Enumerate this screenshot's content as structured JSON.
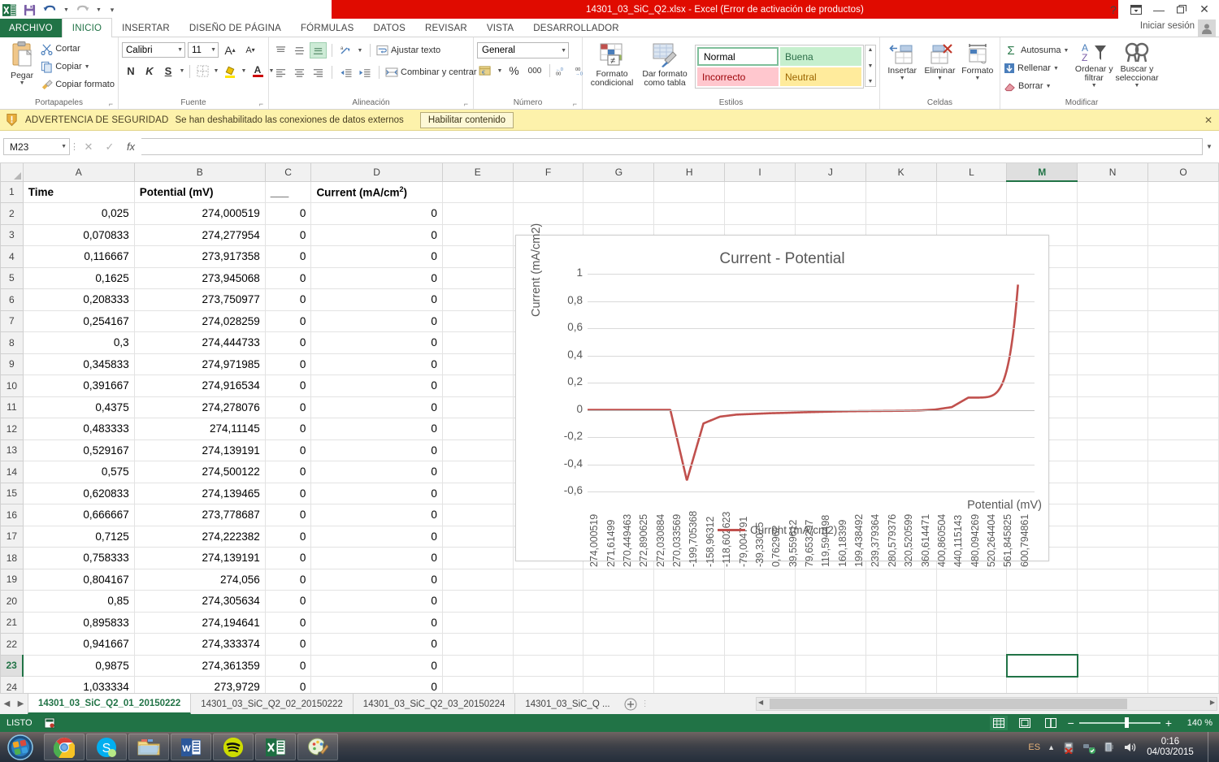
{
  "titlebar": {
    "document_title": "14301_03_SiC_Q2.xlsx  -  Excel (Error de activación de productos)",
    "qat": [
      {
        "name": "save",
        "label": "Guardar"
      },
      {
        "name": "undo",
        "label": "Deshacer"
      },
      {
        "name": "redo",
        "label": "Rehacer"
      },
      {
        "name": "customize",
        "label": "Personalizar barra"
      }
    ],
    "help": "?",
    "ribbon_display": "Opciones de presentación de la cinta",
    "minimize": "—",
    "restore": "❐",
    "close": "✕"
  },
  "ribbon_tabs": {
    "file": "ARCHIVO",
    "items": [
      "INICIO",
      "INSERTAR",
      "DISEÑO DE PÁGINA",
      "FÓRMULAS",
      "DATOS",
      "REVISAR",
      "VISTA",
      "DESARROLLADOR"
    ],
    "active": "INICIO",
    "signin": "Iniciar sesión"
  },
  "ribbon": {
    "clipboard": {
      "label": "Portapapeles",
      "paste": "Pegar",
      "cut": "Cortar",
      "copy": "Copiar",
      "format_painter": "Copiar formato"
    },
    "font": {
      "label": "Fuente",
      "font_name": "Calibri",
      "font_size": "11",
      "grow": "A",
      "shrink": "A",
      "bold": "N",
      "italic": "K",
      "underline": "S",
      "borders": "borders",
      "fill": "A",
      "color": "A"
    },
    "alignment": {
      "label": "Alineación",
      "wrap_text": "Ajustar texto",
      "merge_center": "Combinar y centrar"
    },
    "number": {
      "label": "Número",
      "format": "General",
      "percent": "%",
      "thousands": "000"
    },
    "styles": {
      "label": "Estilos",
      "conditional": "Formato condicional",
      "as_table": "Dar formato como tabla",
      "cells": [
        "Normal",
        "Buena",
        "Incorrecto",
        "Neutral"
      ]
    },
    "cells": {
      "label": "Celdas",
      "insert": "Insertar",
      "delete": "Eliminar",
      "format": "Formato"
    },
    "editing": {
      "label": "Modificar",
      "autosum": "Autosuma",
      "fill": "Rellenar",
      "clear": "Borrar",
      "sort_filter": "Ordenar y filtrar",
      "find_select": "Buscar y seleccionar"
    }
  },
  "security_bar": {
    "title": "ADVERTENCIA DE SEGURIDAD",
    "message": "Se han deshabilitado las conexiones de datos externos",
    "button": "Habilitar contenido",
    "close": "✕"
  },
  "formula_bar": {
    "name_box": "M23",
    "cancel": "✕",
    "enter": "✓",
    "function": "fx",
    "value": ""
  },
  "grid": {
    "columns": [
      "A",
      "B",
      "C",
      "D",
      "E",
      "F",
      "G",
      "H",
      "I",
      "J",
      "K",
      "L",
      "M",
      "N",
      "O"
    ],
    "selected_column": "M",
    "selected_row": "23",
    "selected_cell": "M23",
    "rows": [
      {
        "n": "1",
        "A": "Time",
        "B": "Potential (mV)",
        "C": "___",
        "D": "Current (mA/cm2)",
        "header": true
      },
      {
        "n": "2",
        "A": "0,025",
        "B": "274,000519",
        "C": "0",
        "D": "0"
      },
      {
        "n": "3",
        "A": "0,070833",
        "B": "274,277954",
        "C": "0",
        "D": "0"
      },
      {
        "n": "4",
        "A": "0,116667",
        "B": "273,917358",
        "C": "0",
        "D": "0"
      },
      {
        "n": "5",
        "A": "0,1625",
        "B": "273,945068",
        "C": "0",
        "D": "0"
      },
      {
        "n": "6",
        "A": "0,208333",
        "B": "273,750977",
        "C": "0",
        "D": "0"
      },
      {
        "n": "7",
        "A": "0,254167",
        "B": "274,028259",
        "C": "0",
        "D": "0"
      },
      {
        "n": "8",
        "A": "0,3",
        "B": "274,444733",
        "C": "0",
        "D": "0"
      },
      {
        "n": "9",
        "A": "0,345833",
        "B": "274,971985",
        "C": "0",
        "D": "0"
      },
      {
        "n": "10",
        "A": "0,391667",
        "B": "274,916534",
        "C": "0",
        "D": "0"
      },
      {
        "n": "11",
        "A": "0,4375",
        "B": "274,278076",
        "C": "0",
        "D": "0"
      },
      {
        "n": "12",
        "A": "0,483333",
        "B": "274,11145",
        "C": "0",
        "D": "0"
      },
      {
        "n": "13",
        "A": "0,529167",
        "B": "274,139191",
        "C": "0",
        "D": "0"
      },
      {
        "n": "14",
        "A": "0,575",
        "B": "274,500122",
        "C": "0",
        "D": "0"
      },
      {
        "n": "15",
        "A": "0,620833",
        "B": "274,139465",
        "C": "0",
        "D": "0"
      },
      {
        "n": "16",
        "A": "0,666667",
        "B": "273,778687",
        "C": "0",
        "D": "0"
      },
      {
        "n": "17",
        "A": "0,7125",
        "B": "274,222382",
        "C": "0",
        "D": "0"
      },
      {
        "n": "18",
        "A": "0,758333",
        "B": "274,139191",
        "C": "0",
        "D": "0"
      },
      {
        "n": "19",
        "A": "0,804167",
        "B": "274,056",
        "C": "0",
        "D": "0"
      },
      {
        "n": "20",
        "A": "0,85",
        "B": "274,305634",
        "C": "0",
        "D": "0"
      },
      {
        "n": "21",
        "A": "0,895833",
        "B": "274,194641",
        "C": "0",
        "D": "0"
      },
      {
        "n": "22",
        "A": "0,941667",
        "B": "274,333374",
        "C": "0",
        "D": "0"
      },
      {
        "n": "23",
        "A": "0,9875",
        "B": "274,361359",
        "C": "0",
        "D": "0"
      },
      {
        "n": "24",
        "A": "1,033334",
        "B": "273,9729",
        "C": "0",
        "D": "0"
      }
    ]
  },
  "chart_data": {
    "type": "line",
    "title": "Current - Potential",
    "xlabel": "Potential (mV)",
    "ylabel": "Current (mA/cm2)",
    "legend": [
      "Current (mA/cm2)"
    ],
    "legend_position": "bottom",
    "grid": true,
    "series_color": "#c0504d",
    "ylim": [
      -0.6,
      1.0
    ],
    "yticks": [
      "1",
      "0,8",
      "0,6",
      "0,4",
      "0,2",
      "0",
      "-0,2",
      "-0,4",
      "-0,6"
    ],
    "ytick_values": [
      1,
      0.8,
      0.6,
      0.4,
      0.2,
      0,
      -0.2,
      -0.4,
      -0.6
    ],
    "categories": [
      "274,000519",
      "271,61499",
      "270,449463",
      "272,890625",
      "272,030884",
      "270,033569",
      "-199,705368",
      "-158,96312",
      "-118,602623",
      "-79,004791",
      "-39,33075",
      "0,762962",
      "39,559612",
      "79,653297",
      "119,594498",
      "160,18399",
      "199,438492",
      "239,379364",
      "280,579376",
      "320,520599",
      "360,614471",
      "400,860504",
      "440,115143",
      "480,094269",
      "520,264404",
      "561,845825",
      "600,794861"
    ],
    "series": [
      {
        "name": "Current (mA/cm2)",
        "values": [
          0,
          0,
          0,
          0,
          0,
          0,
          -0.52,
          -0.1,
          -0.05,
          -0.035,
          -0.03,
          -0.025,
          -0.022,
          -0.018,
          -0.015,
          -0.012,
          -0.01,
          -0.009,
          -0.008,
          -0.007,
          -0.005,
          0.002,
          0.02,
          0.09,
          0.1,
          0.13,
          0.92
        ]
      }
    ]
  },
  "sheet_tabs": {
    "prev": "◀",
    "next": "▶",
    "items": [
      {
        "label": "14301_03_SiC_Q2_01_20150222",
        "active": true
      },
      {
        "label": "14301_03_SiC_Q2_02_20150222",
        "active": false
      },
      {
        "label": "14301_03_SiC_Q2_03_20150224",
        "active": false
      },
      {
        "label": "14301_03_SiC_Q ...",
        "active": false
      }
    ],
    "add": "+"
  },
  "status_bar": {
    "state": "LISTO",
    "macro_record": "Grabar macro",
    "views": [
      "Normal",
      "Diseño de página",
      "Vista previa de salto de página"
    ],
    "zoom_out": "−",
    "zoom_in": "+",
    "zoom": "140 %"
  },
  "taskbar": {
    "start": "Inicio",
    "apps": [
      {
        "name": "chrome",
        "label": "Google Chrome"
      },
      {
        "name": "skype",
        "label": "Skype"
      },
      {
        "name": "explorer",
        "label": "Explorador de Windows"
      },
      {
        "name": "word",
        "label": "Word"
      },
      {
        "name": "spotify",
        "label": "Spotify"
      },
      {
        "name": "excel",
        "label": "Excel"
      },
      {
        "name": "paint",
        "label": "Paint"
      }
    ],
    "language": "ES",
    "time": "0:16",
    "date": "04/03/2015"
  },
  "colors": {
    "excel_green": "#217346",
    "title_red": "#e00b00",
    "warning_bg": "#fdf2ab",
    "chart_line": "#c0504d"
  }
}
